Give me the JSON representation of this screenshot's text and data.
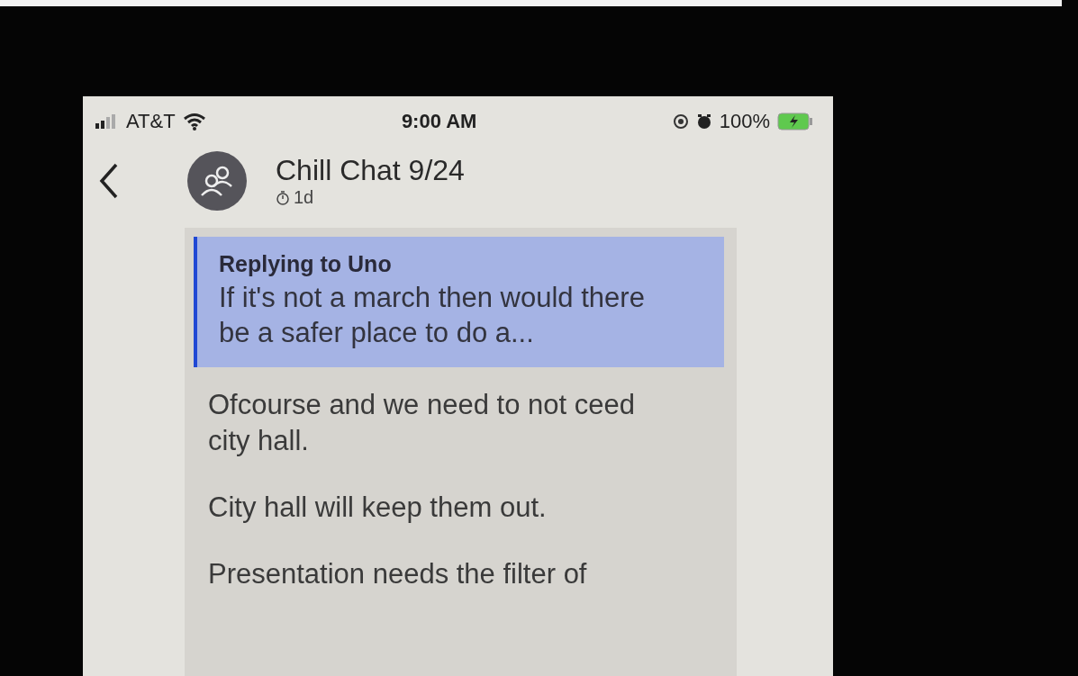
{
  "status_bar": {
    "carrier": "AT&T",
    "time": "9:00 AM",
    "battery": "100%"
  },
  "header": {
    "title": "Chill Chat 9/24",
    "timer": "1d"
  },
  "message": {
    "reply": {
      "label": "Replying to Uno",
      "quote": "If it's not a march then would there be a safer place to do a..."
    },
    "paragraphs": [
      "Ofcourse and we need to not ceed city hall.",
      "City hall will keep them out.",
      "Presentation needs the filter of"
    ]
  }
}
